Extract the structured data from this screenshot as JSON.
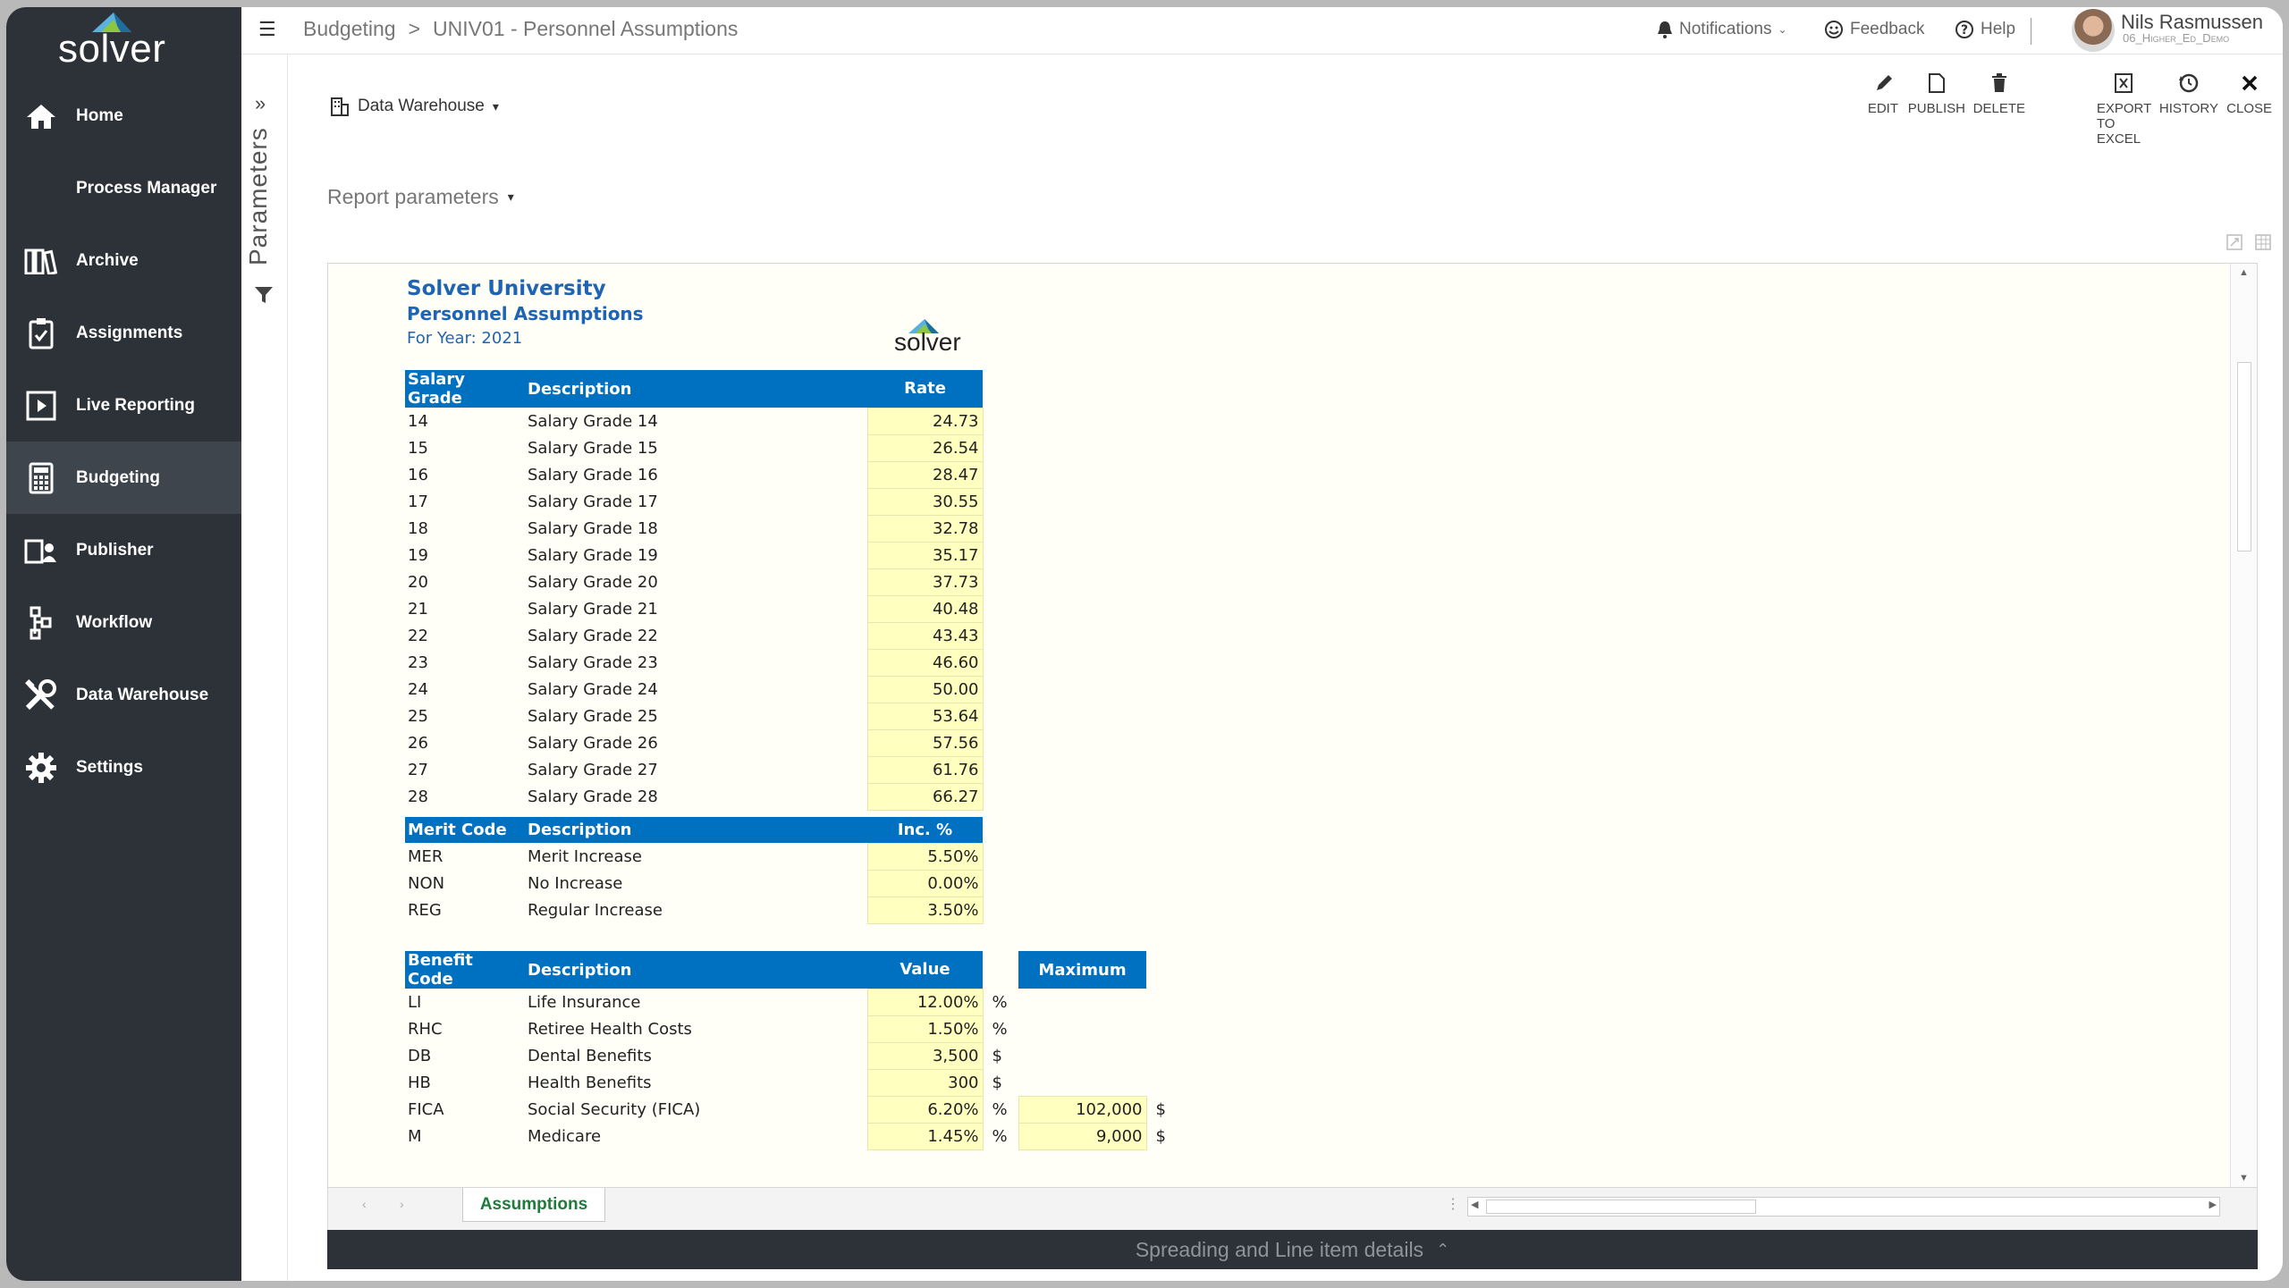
{
  "app": {
    "logo_text": "solver"
  },
  "sidebar": {
    "items": [
      {
        "label": "Home",
        "icon": "home-icon"
      },
      {
        "label": "Process Manager",
        "icon": ""
      },
      {
        "label": "Archive",
        "icon": "archive-icon"
      },
      {
        "label": "Assignments",
        "icon": "clipboard-icon"
      },
      {
        "label": "Live Reporting",
        "icon": "live-reporting-icon"
      },
      {
        "label": "Budgeting",
        "icon": "calculator-icon"
      },
      {
        "label": "Publisher",
        "icon": "publisher-icon"
      },
      {
        "label": "Workflow",
        "icon": "workflow-icon"
      },
      {
        "label": "Data Warehouse",
        "icon": "tools-icon"
      },
      {
        "label": "Settings",
        "icon": "gear-icon"
      }
    ],
    "active": "Budgeting"
  },
  "topbar": {
    "breadcrumb_root": "Budgeting",
    "breadcrumb_sep": ">",
    "breadcrumb_page": "UNIV01 - Personnel Assumptions",
    "notifications": "Notifications",
    "feedback": "Feedback",
    "help": "Help",
    "user_name": "Nils Rasmussen",
    "user_sub": "06_Higher_Ed_Demo"
  },
  "params_panel": {
    "label": "Parameters"
  },
  "main": {
    "data_source": "Data Warehouse",
    "report_parameters": "Report parameters",
    "toolbar": {
      "edit": "EDIT",
      "publish": "PUBLISH",
      "delete": "DELETE",
      "export": "EXPORT TO EXCEL",
      "history": "HISTORY",
      "close": "CLOSE"
    },
    "sheet_tab": "Assumptions",
    "spreading_bar": "Spreading and Line item details"
  },
  "report": {
    "org": "Solver University",
    "title": "Personnel Assumptions",
    "year": "For Year: 2021",
    "logo": "solver",
    "salary": {
      "headers": [
        "Salary Grade",
        "Description",
        "Rate"
      ],
      "rows": [
        [
          "14",
          "Salary Grade 14",
          "24.73"
        ],
        [
          "15",
          "Salary Grade 15",
          "26.54"
        ],
        [
          "16",
          "Salary Grade 16",
          "28.47"
        ],
        [
          "17",
          "Salary Grade 17",
          "30.55"
        ],
        [
          "18",
          "Salary Grade 18",
          "32.78"
        ],
        [
          "19",
          "Salary Grade 19",
          "35.17"
        ],
        [
          "20",
          "Salary Grade 20",
          "37.73"
        ],
        [
          "21",
          "Salary Grade 21",
          "40.48"
        ],
        [
          "22",
          "Salary Grade 22",
          "43.43"
        ],
        [
          "23",
          "Salary Grade 23",
          "46.60"
        ],
        [
          "24",
          "Salary Grade 24",
          "50.00"
        ],
        [
          "25",
          "Salary Grade 25",
          "53.64"
        ],
        [
          "26",
          "Salary Grade 26",
          "57.56"
        ],
        [
          "27",
          "Salary Grade 27",
          "61.76"
        ],
        [
          "28",
          "Salary Grade 28",
          "66.27"
        ]
      ]
    },
    "merit": {
      "headers": [
        "Merit Code",
        "Description",
        "Inc. %"
      ],
      "rows": [
        [
          "MER",
          "Merit Increase",
          "5.50%"
        ],
        [
          "NON",
          "No Increase",
          "0.00%"
        ],
        [
          "REG",
          "Regular Increase",
          "3.50%"
        ]
      ]
    },
    "benefit": {
      "headers": [
        "Benefit Code",
        "Description",
        "Value",
        "Maximum"
      ],
      "rows": [
        [
          "LI",
          "Life Insurance",
          "12.00%",
          "%",
          "",
          ""
        ],
        [
          "RHC",
          "Retiree Health Costs",
          "1.50%",
          "%",
          "",
          ""
        ],
        [
          "DB",
          "Dental Benefits",
          "3,500",
          "$",
          "",
          ""
        ],
        [
          "HB",
          "Health Benefits",
          "300",
          "$",
          "",
          ""
        ],
        [
          "FICA",
          "Social Security (FICA)",
          "6.20%",
          "%",
          "102,000",
          "$"
        ],
        [
          "M",
          "Medicare",
          "1.45%",
          "%",
          "9,000",
          "$"
        ]
      ]
    }
  },
  "colors": {
    "sidebar_bg": "#2d3239",
    "header_blue": "#0070c0",
    "input_yellow": "#ffffc0",
    "title_blue": "#1e64b4"
  }
}
